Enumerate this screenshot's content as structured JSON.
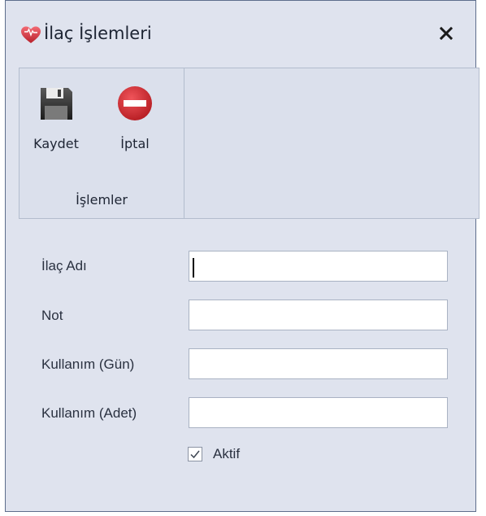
{
  "window": {
    "title": "İlaç İşlemleri",
    "close_symbol": "✕",
    "icon": "heart-icon"
  },
  "ribbon": {
    "save_label": "Kaydet",
    "cancel_label": "İptal",
    "group_label": "İşlemler",
    "save_icon": "floppy-disk-icon",
    "cancel_icon": "stop-sign-icon"
  },
  "form": {
    "fields": [
      {
        "label": "İlaç Adı",
        "value": "",
        "placeholder": ""
      },
      {
        "label": "Not",
        "value": "",
        "placeholder": ""
      },
      {
        "label": "Kullanım (Gün)",
        "value": "",
        "placeholder": ""
      },
      {
        "label": "Kullanım (Adet)",
        "value": "",
        "placeholder": ""
      }
    ],
    "checkbox": {
      "label": "Aktif",
      "checked": true
    }
  },
  "colors": {
    "window_bg": "#dfe3ee",
    "ribbon_bg": "#dbe0ec",
    "accent_red": "#c8272d"
  }
}
